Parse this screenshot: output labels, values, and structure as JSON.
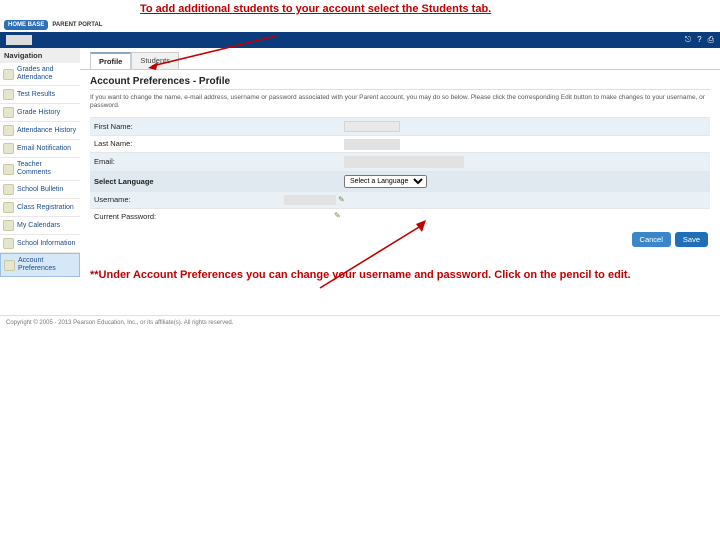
{
  "annotations": {
    "top": "To add additional students to your account select the Students tab.",
    "bottom": "**Under Account Preferences you can change your username and password.  Click on the pencil to edit."
  },
  "brand": {
    "badge": "HOME BASE",
    "sub": "PARENT PORTAL"
  },
  "topbar_icons": {
    "logout": "⎋",
    "help": "?",
    "print": "⎙"
  },
  "sidebar": {
    "heading": "Navigation",
    "items": [
      {
        "label": "Grades and Attendance"
      },
      {
        "label": "Test Results"
      },
      {
        "label": "Grade History"
      },
      {
        "label": "Attendance History"
      },
      {
        "label": "Email Notification"
      },
      {
        "label": "Teacher Comments"
      },
      {
        "label": "School Bulletin"
      },
      {
        "label": "Class Registration"
      },
      {
        "label": "My Calendars"
      },
      {
        "label": "School Information"
      },
      {
        "label": "Account Preferences",
        "selected": true
      }
    ]
  },
  "tabs": {
    "profile": "Profile",
    "students": "Students"
  },
  "panel": {
    "title": "Account Preferences - Profile",
    "desc": "If you want to change the name, e-mail address, username or password associated with your Parent account, you may do so below. Please click the corresponding Edit button to make changes to your username, or password."
  },
  "form": {
    "first": "First Name:",
    "last": "Last Name:",
    "email": "Email:",
    "lang": "Select Language",
    "user": "Username:",
    "pass": "Current Password:",
    "lang_value": "Select a Language",
    "pass_masked": ""
  },
  "buttons": {
    "cancel": "Cancel",
    "save": "Save"
  },
  "footer": "Copyright © 2005 - 2013 Pearson Education, Inc., or its affiliate(s). All rights reserved."
}
